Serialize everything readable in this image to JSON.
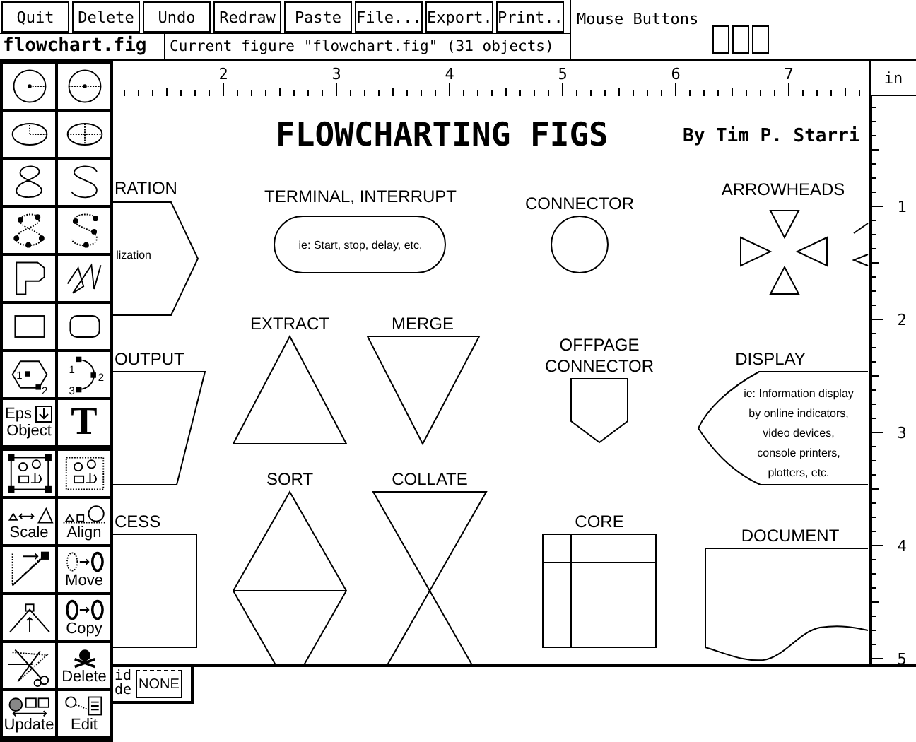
{
  "menu_buttons": [
    "Quit",
    "Delete",
    "Undo",
    "Redraw",
    "Paste",
    "File...",
    "Export.",
    "Print.."
  ],
  "mouse_buttons": {
    "title": "Mouse Buttons"
  },
  "file_name": "flowchart.fig",
  "message": "Current figure \"flowchart.fig\" (31 objects)",
  "units": "in",
  "top_ruler": {
    "labels": [
      "2",
      "3",
      "4",
      "5",
      "6",
      "7"
    ]
  },
  "side_ruler": {
    "labels": [
      "1",
      "2",
      "3",
      "4",
      "5"
    ]
  },
  "toolbar": {
    "drawing_modes": [
      {
        "kind": "circle-radius"
      },
      {
        "kind": "circle-diameter"
      },
      {
        "kind": "ellipse-radius"
      },
      {
        "kind": "ellipse-diameter"
      },
      {
        "kind": "closed-spline"
      },
      {
        "kind": "open-spline"
      },
      {
        "kind": "closed-interp-spline"
      },
      {
        "kind": "open-interp-spline"
      },
      {
        "kind": "polygon"
      },
      {
        "kind": "polyline"
      },
      {
        "kind": "box"
      },
      {
        "kind": "arc-box"
      },
      {
        "kind": "regular-polygon",
        "marks": [
          "1",
          "2"
        ]
      },
      {
        "kind": "arc",
        "marks": [
          "1",
          "2",
          "3"
        ]
      },
      {
        "kind": "eps",
        "label_lines": [
          "Eps",
          "Object"
        ]
      },
      {
        "kind": "text",
        "label": "T"
      }
    ],
    "editing_modes": [
      {
        "kind": "compound"
      },
      {
        "kind": "break"
      },
      {
        "kind": "scale",
        "label": "Scale"
      },
      {
        "kind": "align",
        "label": "Align"
      },
      {
        "kind": "add-point"
      },
      {
        "kind": "move",
        "label": "Move"
      },
      {
        "kind": "delete-point"
      },
      {
        "kind": "copy",
        "label": "Copy"
      },
      {
        "kind": "cut"
      },
      {
        "kind": "delete",
        "label": "Delete"
      },
      {
        "kind": "update",
        "label": "Update"
      },
      {
        "kind": "edit",
        "label": "Edit"
      }
    ]
  },
  "canvas": {
    "title": "FLOWCHARTING FIGS",
    "author": "By Tim P. Starri",
    "shapes": [
      {
        "kind": "preparation",
        "label_lines": [
          "RATION"
        ],
        "text_lines": [
          "lization"
        ]
      },
      {
        "kind": "terminal",
        "label_lines": [
          "TERMINAL, INTERRUPT"
        ],
        "text_lines": [
          "ie: Start, stop, delay, etc."
        ]
      },
      {
        "kind": "connector",
        "label_lines": [
          "CONNECTOR"
        ]
      },
      {
        "kind": "arrowheads",
        "label_lines": [
          "ARROWHEADS"
        ]
      },
      {
        "kind": "output",
        "label_lines": [
          "OUTPUT"
        ]
      },
      {
        "kind": "extract",
        "label_lines": [
          "EXTRACT"
        ]
      },
      {
        "kind": "merge",
        "label_lines": [
          "MERGE"
        ]
      },
      {
        "kind": "offpage",
        "label_lines": [
          "OFFPAGE",
          "CONNECTOR"
        ]
      },
      {
        "kind": "display",
        "label_lines": [
          "DISPLAY"
        ],
        "text_lines": [
          "ie: Information display",
          "by online indicators,",
          "video devices,",
          "console printers,",
          "plotters, etc."
        ]
      },
      {
        "kind": "process",
        "label_lines": [
          "CESS"
        ]
      },
      {
        "kind": "sort",
        "label_lines": [
          "SORT"
        ]
      },
      {
        "kind": "collate",
        "label_lines": [
          "COLLATE"
        ]
      },
      {
        "kind": "core",
        "label_lines": [
          "CORE"
        ]
      },
      {
        "kind": "document",
        "label_lines": [
          "DOCUMENT"
        ]
      }
    ]
  },
  "grid_mode": {
    "label_lines": [
      "id",
      "de"
    ],
    "value": "NONE"
  }
}
